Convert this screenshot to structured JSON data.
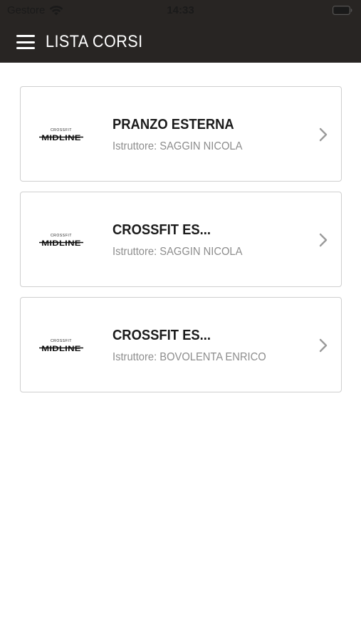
{
  "status_bar": {
    "carrier": "Gestore",
    "time": "14:33",
    "wifi_icon": "wifi-icon",
    "battery_icon": "battery-icon"
  },
  "nav": {
    "title": "LISTA CORSI",
    "menu_icon": "hamburger-menu-icon"
  },
  "logo": {
    "top_text": "CROSSFIT",
    "main_text": "MIDLINE"
  },
  "courses": [
    {
      "name": "PRANZO ESTERNA",
      "instructor": "Istruttore: SAGGIN NICOLA"
    },
    {
      "name": "CROSSFIT ES...",
      "instructor": "Istruttore: SAGGIN NICOLA"
    },
    {
      "name": "CROSSFIT ES...",
      "instructor": "Istruttore: BOVOLENTA ENRICO"
    }
  ],
  "colors": {
    "header_bg": "#282523",
    "title_text": "#ffffff",
    "course_name": "#1b1b1b",
    "instructor_text": "#8d8d8d",
    "card_border": "#cfcfcf",
    "chevron": "#9a9a9a"
  }
}
